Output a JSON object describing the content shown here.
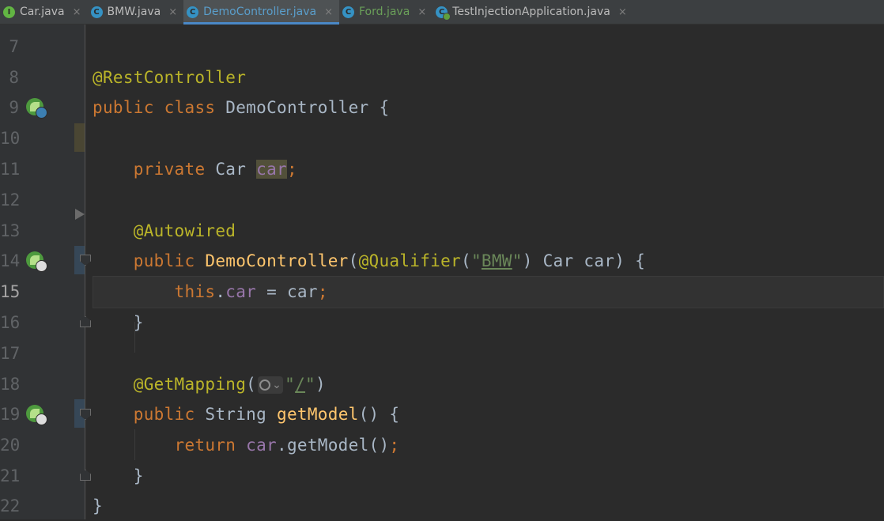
{
  "tabs": [
    {
      "label": "Car.java",
      "icon": "interface-icon",
      "icon_letter": "I",
      "state": "normal"
    },
    {
      "label": "BMW.java",
      "icon": "class-icon",
      "icon_letter": "C",
      "state": "normal"
    },
    {
      "label": "DemoController.java",
      "icon": "class-icon",
      "icon_letter": "C",
      "state": "active"
    },
    {
      "label": "Ford.java",
      "icon": "class-icon",
      "icon_letter": "C",
      "state": "modified"
    },
    {
      "label": "TestInjectionApplication.java",
      "icon": "spring-app-icon",
      "icon_letter": "C",
      "state": "normal"
    }
  ],
  "tab_close_glyph": "×",
  "colors": {
    "keyword": "#cc7832",
    "annotation": "#bbb529",
    "method": "#ffc66d",
    "field": "#9876aa",
    "string": "#6a8759",
    "plain": "#a9b7c6",
    "background": "#2b2b2b"
  },
  "editor": {
    "current_line": "15",
    "lines": [
      {
        "n": "7",
        "text": ""
      },
      {
        "n": "8",
        "text": "@RestController"
      },
      {
        "n": "9",
        "text": "public class DemoController {"
      },
      {
        "n": "10",
        "text": ""
      },
      {
        "n": "11",
        "text": "    private Car car;"
      },
      {
        "n": "12",
        "text": ""
      },
      {
        "n": "13",
        "text": "    @Autowired"
      },
      {
        "n": "14",
        "text": "    public DemoController(@Qualifier(\"BMW\") Car car) {"
      },
      {
        "n": "15",
        "text": "        this.car = car;"
      },
      {
        "n": "16",
        "text": "    }"
      },
      {
        "n": "17",
        "text": ""
      },
      {
        "n": "18",
        "text": "    @GetMapping(\"/\")"
      },
      {
        "n": "19",
        "text": "    public String getModel() {"
      },
      {
        "n": "20",
        "text": "        return car.getModel();"
      },
      {
        "n": "21",
        "text": "    }"
      },
      {
        "n": "22",
        "text": "}"
      }
    ],
    "tokens": {
      "rest_controller": "@RestController",
      "public": "public",
      "class": "class",
      "class_name": "DemoController",
      "open_brace": "{",
      "private": "private",
      "car_type": "Car",
      "car_field": "car",
      "semicolon": ";",
      "autowired": "@Autowired",
      "ctor_name": "DemoController",
      "qualifier": "@Qualifier",
      "paren_open": "(",
      "paren_close": ")",
      "quote": "\"",
      "bmw": "BMW",
      "param": "Car car",
      "this": "this",
      "dot": ".",
      "assign": " = ",
      "car_param": "car",
      "close_brace": "}",
      "get_mapping": "@GetMapping",
      "slash": "/",
      "string_type": "String",
      "get_model": "getModel",
      "parens": "()",
      "return": "return",
      "inlay_chevron": "⌄"
    }
  }
}
